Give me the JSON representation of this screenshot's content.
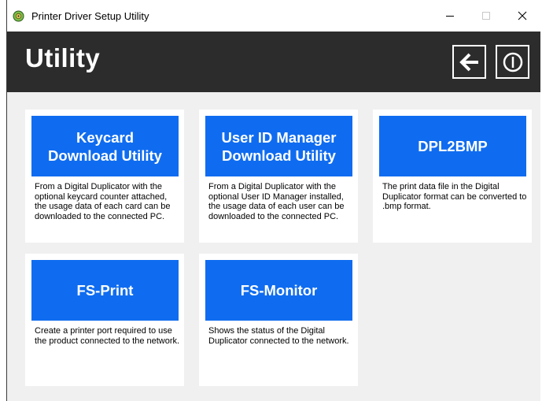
{
  "window": {
    "title": "Printer Driver Setup Utility",
    "controls": {
      "minimize": "—",
      "maximize": "☐",
      "close": "✕"
    }
  },
  "header": {
    "title": "Utility"
  },
  "tiles": [
    {
      "label": "Keycard\nDownload Utility",
      "description": "From a Digital Duplicator with the optional keycard counter attached, the usage data of each card can be downloaded to the connected PC."
    },
    {
      "label": "User ID Manager\nDownload Utility",
      "description": "From a Digital Duplicator with the optional User ID Manager installed, the usage data of each user can be downloaded to the connected PC."
    },
    {
      "label": "DPL2BMP",
      "description": "The print data file in the Digital Duplicator format can be converted to .bmp format."
    },
    {
      "label": "FS-Print",
      "description": "Create a printer port required to use the product connected to the network."
    },
    {
      "label": "FS-Monitor",
      "description": "Shows the status of the Digital Duplicator connected to the network."
    }
  ],
  "colors": {
    "tile_button": "#0f6cf0",
    "header_bg": "#2c2c2c",
    "content_bg": "#f0f0f0"
  },
  "icons": {
    "app": "printer-app-icon",
    "back": "back-arrow-icon",
    "power": "power-icon"
  }
}
